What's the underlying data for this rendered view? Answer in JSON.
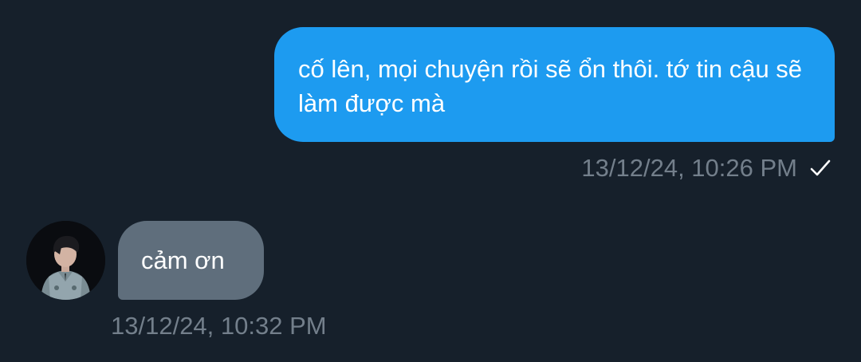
{
  "conversation": {
    "messages": [
      {
        "direction": "outgoing",
        "text": "cố lên, mọi chuyện rồi sẽ ổn thôi. tớ tin cậu sẽ làm được mà",
        "timestamp": "13/12/24, 10:26 PM",
        "status_icon": "check-icon"
      },
      {
        "direction": "incoming",
        "text": "cảm ơn",
        "timestamp": "13/12/24, 10:32 PM",
        "avatar_icon": "avatar"
      }
    ]
  },
  "colors": {
    "background": "#16202b",
    "outgoing_bubble": "#1d9bf0",
    "incoming_bubble": "#5f6e7c",
    "timestamp_text": "#737f8b",
    "message_text": "#ffffff"
  }
}
